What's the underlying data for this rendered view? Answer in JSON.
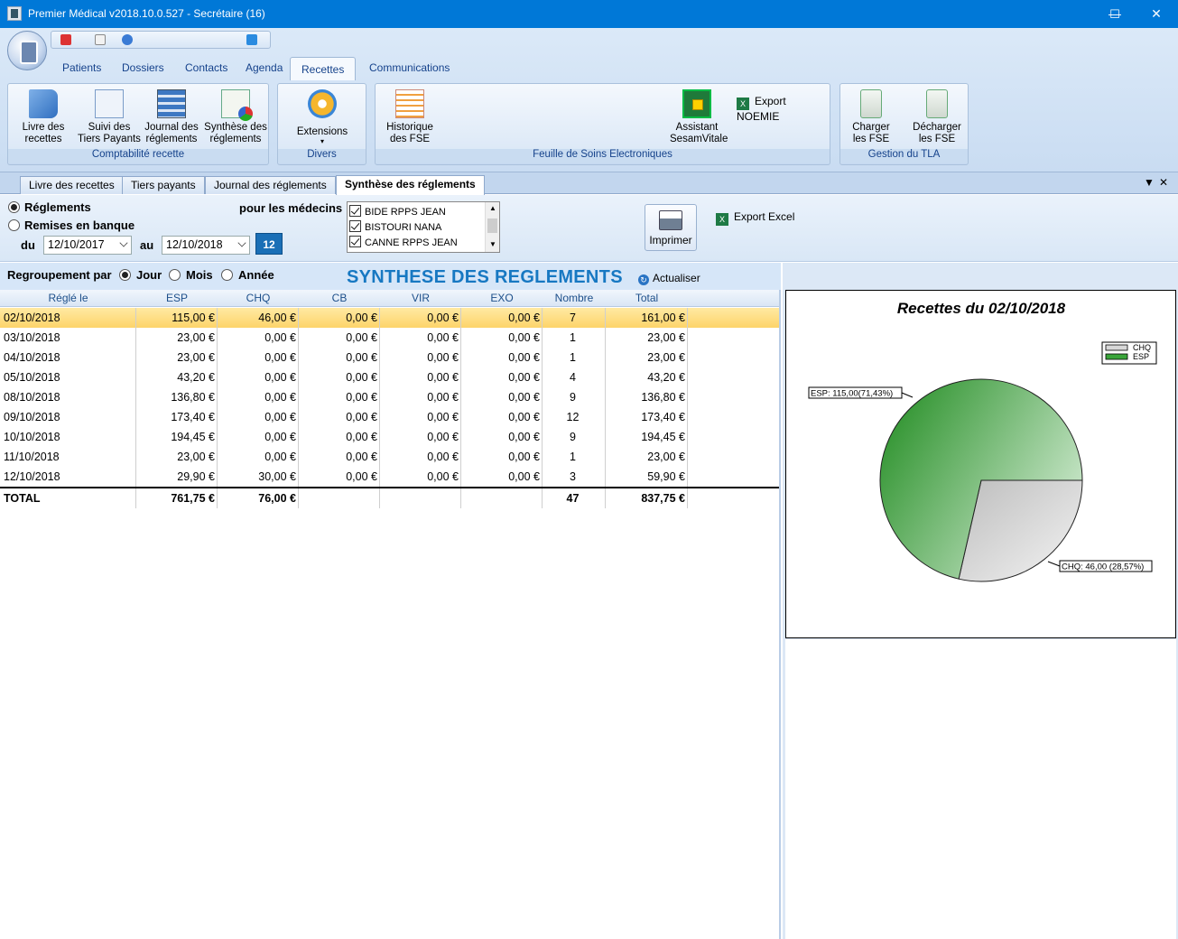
{
  "window": {
    "title": "Premier Médical v2018.10.0.527 - Secrétaire  (16)",
    "minimize": "—",
    "maximize": "☐",
    "close": "✕"
  },
  "ribbon_tabs": [
    "Patients",
    "Dossiers",
    "Contacts",
    "Agenda",
    "Recettes",
    "Communications"
  ],
  "ribbon_active_tab": "Recettes",
  "ribbon_groups": {
    "comptabilite": {
      "title": "Comptabilité recette",
      "buttons": [
        "Livre des recettes",
        "Suivi des Tiers Payants",
        "Journal des réglements",
        "Synthèse des réglements"
      ]
    },
    "divers": {
      "title": "Divers",
      "buttons": [
        "Extensions"
      ]
    },
    "fse": {
      "title": "Feuille de Soins Electroniques",
      "buttons": [
        "Historique des FSE",
        "Assistant SesamVitale",
        "Export NOEMIE"
      ]
    },
    "tla": {
      "title": "Gestion du TLA",
      "buttons": [
        "Charger les FSE",
        "Décharger les FSE"
      ]
    }
  },
  "doc_tabs": [
    "Livre des recettes",
    "Tiers payants",
    "Journal des réglements",
    "Synthèse des réglements"
  ],
  "doc_tab_active": "Synthèse des réglements",
  "filters": {
    "mode_reglements": "Réglements",
    "mode_remises": "Remises en banque",
    "pour_medecins": "pour les médecins",
    "du_label": "du",
    "au_label": "au",
    "date_from": "12/10/2017",
    "date_to": "12/10/2018",
    "cal_day": "12",
    "medecins": [
      "BIDE RPPS JEAN",
      "BISTOURI NANA",
      "CANNE RPPS JEAN"
    ],
    "print_label": "Imprimer",
    "export_excel": "Export Excel",
    "regroupement_label": "Regroupement par",
    "group_options": [
      "Jour",
      "Mois",
      "Année"
    ],
    "group_selected": "Jour"
  },
  "main": {
    "title": "SYNTHESE DES REGLEMENTS",
    "refresh_label": "Actualiser"
  },
  "table": {
    "headers": [
      "Réglé le",
      "ESP",
      "CHQ",
      "CB",
      "VIR",
      "EXO",
      "Nombre",
      "Total"
    ],
    "rows": [
      [
        "02/10/2018",
        "115,00 €",
        "46,00 €",
        "0,00 €",
        "0,00 €",
        "0,00 €",
        "7",
        "161,00 €"
      ],
      [
        "03/10/2018",
        "23,00 €",
        "0,00 €",
        "0,00 €",
        "0,00 €",
        "0,00 €",
        "1",
        "23,00 €"
      ],
      [
        "04/10/2018",
        "23,00 €",
        "0,00 €",
        "0,00 €",
        "0,00 €",
        "0,00 €",
        "1",
        "23,00 €"
      ],
      [
        "05/10/2018",
        "43,20 €",
        "0,00 €",
        "0,00 €",
        "0,00 €",
        "0,00 €",
        "4",
        "43,20 €"
      ],
      [
        "08/10/2018",
        "136,80 €",
        "0,00 €",
        "0,00 €",
        "0,00 €",
        "0,00 €",
        "9",
        "136,80 €"
      ],
      [
        "09/10/2018",
        "173,40 €",
        "0,00 €",
        "0,00 €",
        "0,00 €",
        "0,00 €",
        "12",
        "173,40 €"
      ],
      [
        "10/10/2018",
        "194,45 €",
        "0,00 €",
        "0,00 €",
        "0,00 €",
        "0,00 €",
        "9",
        "194,45 €"
      ],
      [
        "11/10/2018",
        "23,00 €",
        "0,00 €",
        "0,00 €",
        "0,00 €",
        "0,00 €",
        "1",
        "23,00 €"
      ],
      [
        "12/10/2018",
        "29,90 €",
        "30,00 €",
        "0,00 €",
        "0,00 €",
        "0,00 €",
        "3",
        "59,90 €"
      ]
    ],
    "total": [
      "TOTAL",
      "761,75 €",
      "76,00 €",
      "",
      "",
      "",
      "47",
      "837,75 €"
    ],
    "selected_row": 0
  },
  "chart_data": {
    "type": "pie",
    "title": "Recettes du 02/10/2018",
    "slices": [
      {
        "name": "ESP",
        "value": 115.0,
        "label": "ESP: 115,00(71,43%)",
        "color": "#2e9a2e"
      },
      {
        "name": "CHQ",
        "value": 46.0,
        "label": "CHQ: 46,00 (28,57%)",
        "color": "#d4d4d4"
      }
    ],
    "legend": [
      "CHQ",
      "ESP"
    ],
    "legend_position": "top-right"
  },
  "colors": {
    "titlebar": "#0078d7",
    "accent_title": "#1778c2",
    "selected_row": "#fddf86"
  }
}
